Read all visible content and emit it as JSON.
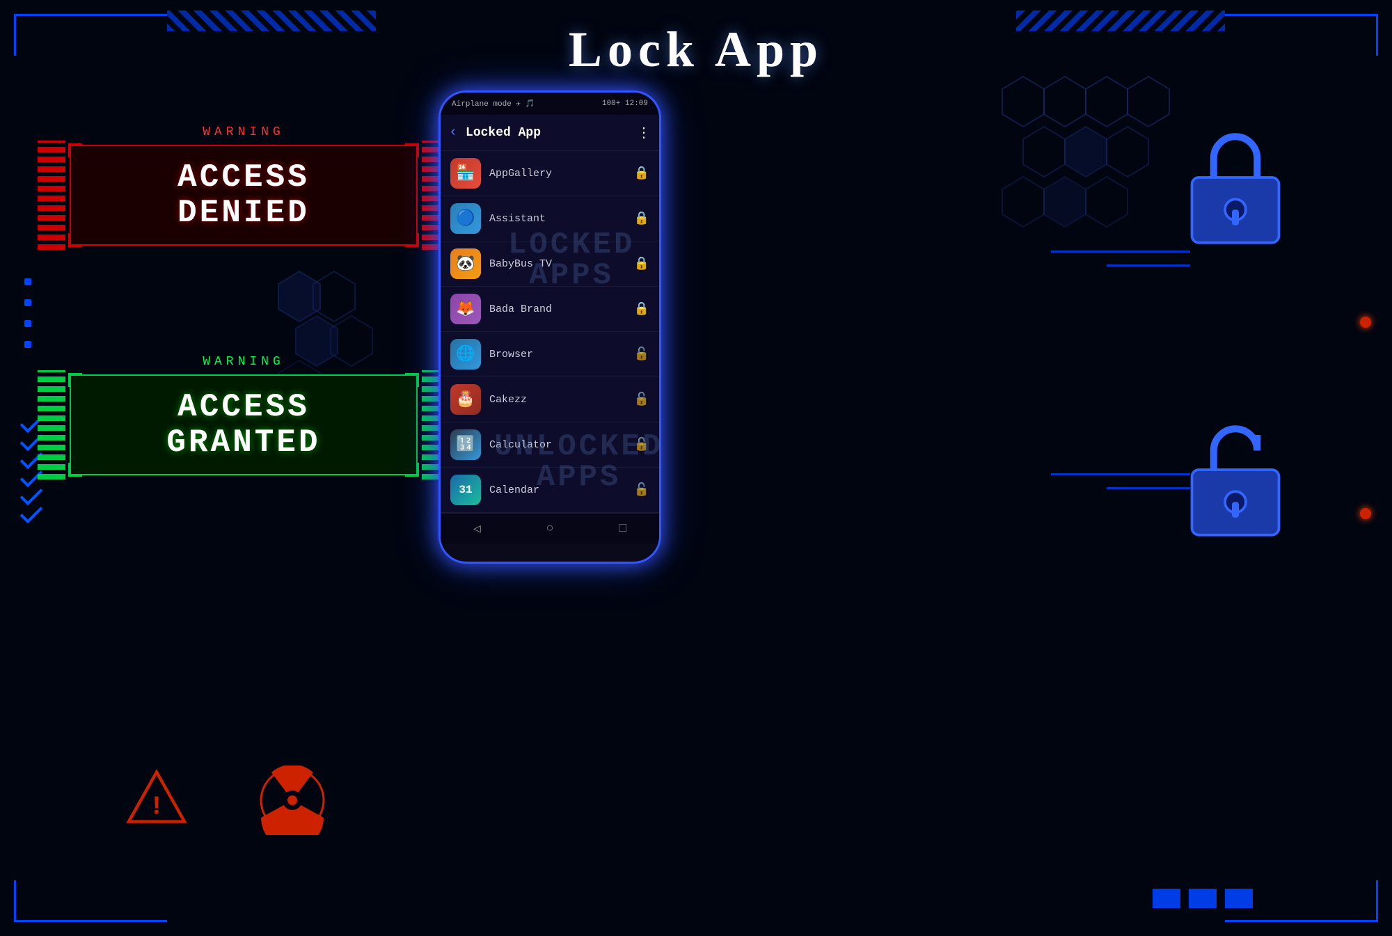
{
  "page": {
    "title": "Lock  App",
    "background_color": "#000510"
  },
  "access_denied": {
    "warning_label": "WARNING",
    "text_line1": "ACCESS",
    "text_line2": "DENIED"
  },
  "access_granted": {
    "warning_label": "WARNING",
    "text_line1": "ACCESS",
    "text_line2": "GRANTED"
  },
  "phone": {
    "status_bar": {
      "left": "Airplane mode ✈ 🎵",
      "right": "100+ 12:09"
    },
    "header": {
      "title": "Locked App",
      "back_label": "‹",
      "menu_label": "⋮"
    },
    "watermark_locked": "LOCKED\nAPPS",
    "watermark_unlocked": "UNLOCKED\nAPPS",
    "apps": [
      {
        "name": "AppGallery",
        "icon": "🏪",
        "icon_class": "app-icon-appgallery",
        "locked": true
      },
      {
        "name": "Assistant",
        "icon": "🔵",
        "icon_class": "app-icon-assistant",
        "locked": true
      },
      {
        "name": "BabyBus TV",
        "icon": "🐼",
        "icon_class": "app-icon-babybus",
        "locked": true
      },
      {
        "name": "Bada Brand",
        "icon": "🦊",
        "icon_class": "app-icon-bada",
        "locked": true
      },
      {
        "name": "Browser",
        "icon": "🌐",
        "icon_class": "app-icon-browser",
        "locked": false
      },
      {
        "name": "Cakezz",
        "icon": "🎂",
        "icon_class": "app-icon-cakezz",
        "locked": false
      },
      {
        "name": "Calculator",
        "icon": "🔢",
        "icon_class": "app-icon-calculator",
        "locked": false
      },
      {
        "name": "Calendar",
        "icon": "📅",
        "icon_class": "app-icon-calendar",
        "locked": false
      }
    ],
    "nav": {
      "back": "◁",
      "home": "○",
      "recent": "□"
    }
  },
  "bottom_squares": [
    "sq1",
    "sq2",
    "sq3"
  ]
}
